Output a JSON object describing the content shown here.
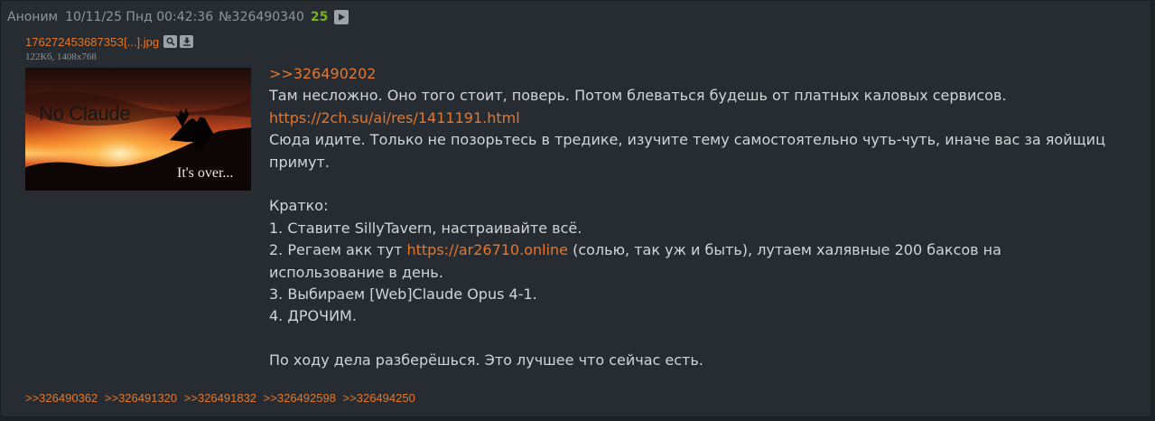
{
  "header": {
    "name": "Аноним",
    "date": "10/11/25 Пнд 00:42:36",
    "post_number": "№326490340",
    "count": "25"
  },
  "file": {
    "name": "17627245368735З[...].jpg",
    "meta": "122Кб, 1408x768",
    "thumb_text_main": "No Claude",
    "thumb_text_sub": "It's over..."
  },
  "body": {
    "quote_ref": ">>326490202",
    "line1": "Там несложно. Оно того стоит, поверь. Потом блеваться будешь от платных каловых сервисов.",
    "link1": "https://2ch.su/ai/res/1411191.html",
    "line3": "Сюда идите. Только не позорьтесь в тредике, изучите тему самостоятельно чуть-чуть, иначе вас за яойщиц",
    "line4": "примут.",
    "short_title": "Кратко:",
    "step1": "1. Ставите SillyTavern, настраивайте всё.",
    "step2_pre": "2. Регаем акк тут ",
    "step2_link": "https://ar26710.online",
    "step2_post": " (солью, так уж и быть), лутаем халявные 200 баксов на",
    "step2_cont": "использование в день.",
    "step3": "3. Выбираем [Web]Claude Opus 4-1.",
    "step4": "4. ДРОЧИМ.",
    "closing": "По ходу дела разберёшься. Это лучшее что сейчас есть."
  },
  "replies": [
    ">>326490362",
    ">>326491320",
    ">>326491832",
    ">>326492598",
    ">>326494250"
  ],
  "icons": {
    "play": "play-icon",
    "search": "search-icon",
    "download": "download-icon"
  },
  "colors": {
    "background": "#262c31",
    "link": "#e5772c",
    "count": "#74b41a",
    "text": "#d2d5d8",
    "meta": "#8f969c"
  }
}
